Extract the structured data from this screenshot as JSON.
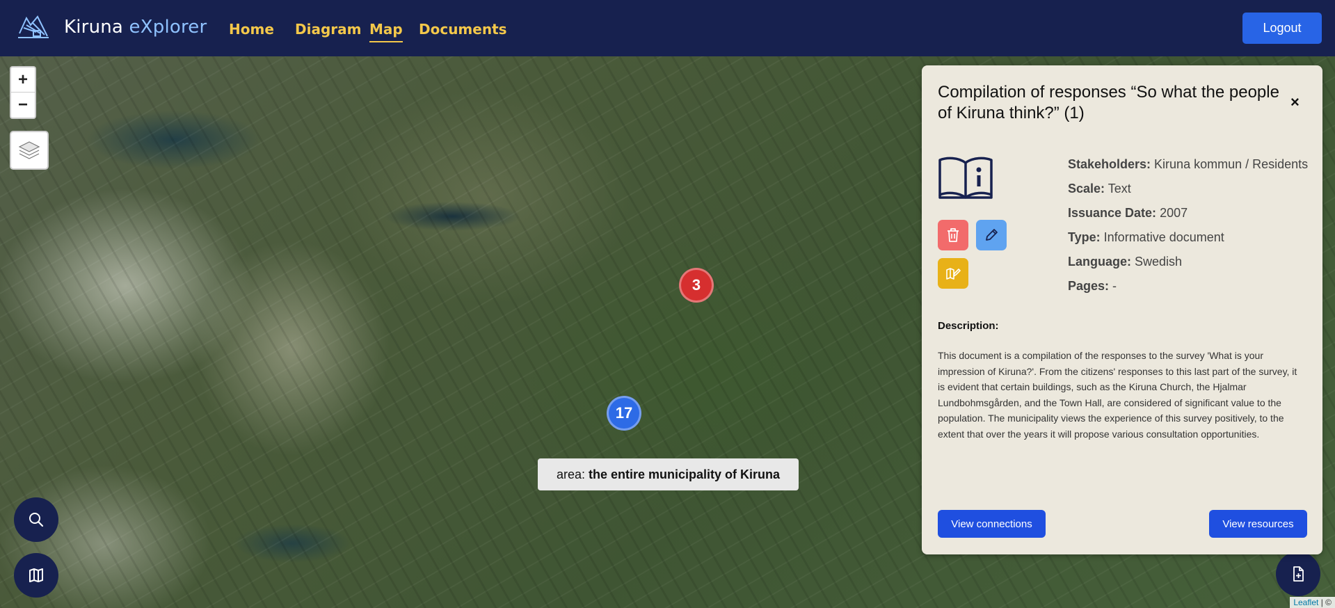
{
  "navbar": {
    "brand_main": "Kiruna ",
    "brand_highlight": "eXplorer",
    "links": [
      {
        "label": "Home"
      },
      {
        "label": "Diagram"
      },
      {
        "label": "Map"
      },
      {
        "label": "Documents"
      }
    ],
    "logout_label": "Logout"
  },
  "map": {
    "zoom_in": "+",
    "zoom_out": "−",
    "clusters": [
      {
        "count": "3",
        "color": "#d62f2f"
      },
      {
        "count": "17",
        "color": "#2d6be6"
      }
    ],
    "area_prefix": "area:",
    "area_value": "the entire municipality of Kiruna",
    "attribution_link": "Leaflet",
    "attribution_rest": " | ©"
  },
  "panel": {
    "title": "Compilation of responses “So what the people of Kiruna think?” (1)",
    "close": "×",
    "meta": [
      {
        "label": "Stakeholders:",
        "value": " Kiruna kommun / Residents"
      },
      {
        "label": "Scale:",
        "value": " Text"
      },
      {
        "label": "Issuance Date:",
        "value": " 2007"
      },
      {
        "label": "Type:",
        "value": " Informative document"
      },
      {
        "label": "Language:",
        "value": " Swedish"
      },
      {
        "label": "Pages:",
        "value": " -"
      }
    ],
    "description_heading": "Description:",
    "description": "This document is a compilation of the responses to the survey 'What is your impression of Kiruna?'. From the citizens' responses to this last part of the survey, it is evident that certain buildings, such as the Kiruna Church, the Hjalmar Lundbohmsgården, and the Town Hall, are considered of significant value to the population. The municipality views the experience of this survey positively, to the extent that over the years it will propose various consultation opportunities.",
    "view_connections_label": "View connections",
    "view_resources_label": "View resources"
  },
  "colors": {
    "navbar": "#17214f",
    "nav_link": "#f4c84a",
    "primary_button": "#2864e6",
    "panel_bg": "#ece8dd",
    "delete": "#f26b6b",
    "edit": "#5fa3f0",
    "map_edit": "#e8b118"
  }
}
